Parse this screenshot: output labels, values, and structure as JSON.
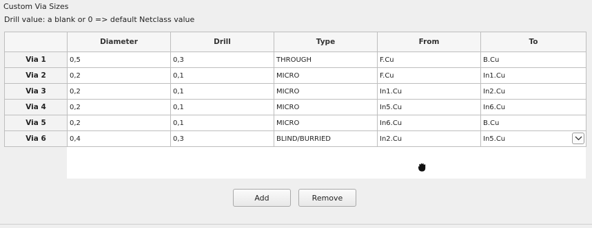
{
  "section_title": "Custom Via Sizes",
  "hint": "Drill value: a blank or 0 => default Netclass value",
  "columns": [
    "Diameter",
    "Drill",
    "Type",
    "From",
    "To"
  ],
  "rows": [
    {
      "label": "Via 1",
      "diameter": "0,5",
      "drill": "0,3",
      "type": "THROUGH",
      "from": "F.Cu",
      "to": "B.Cu"
    },
    {
      "label": "Via 2",
      "diameter": "0,2",
      "drill": "0,1",
      "type": "MICRO",
      "from": "F.Cu",
      "to": "In1.Cu"
    },
    {
      "label": "Via 3",
      "diameter": "0,2",
      "drill": "0,1",
      "type": "MICRO",
      "from": "In1.Cu",
      "to": "In2.Cu"
    },
    {
      "label": "Via 4",
      "diameter": "0,2",
      "drill": "0,1",
      "type": "MICRO",
      "from": "In5.Cu",
      "to": "In6.Cu"
    },
    {
      "label": "Via 5",
      "diameter": "0,2",
      "drill": "0,1",
      "type": "MICRO",
      "from": "In6.Cu",
      "to": "B.Cu"
    },
    {
      "label": "Via 6",
      "diameter": "0,4",
      "drill": "0,3",
      "type": "BLIND/BURRIED",
      "from": "In2.Cu",
      "to": "In5.Cu"
    }
  ],
  "dropdown_icon": "chevron-down-icon",
  "cursor_icon": "hand-grab-cursor-icon",
  "buttons": {
    "add": "Add",
    "remove": "Remove"
  }
}
